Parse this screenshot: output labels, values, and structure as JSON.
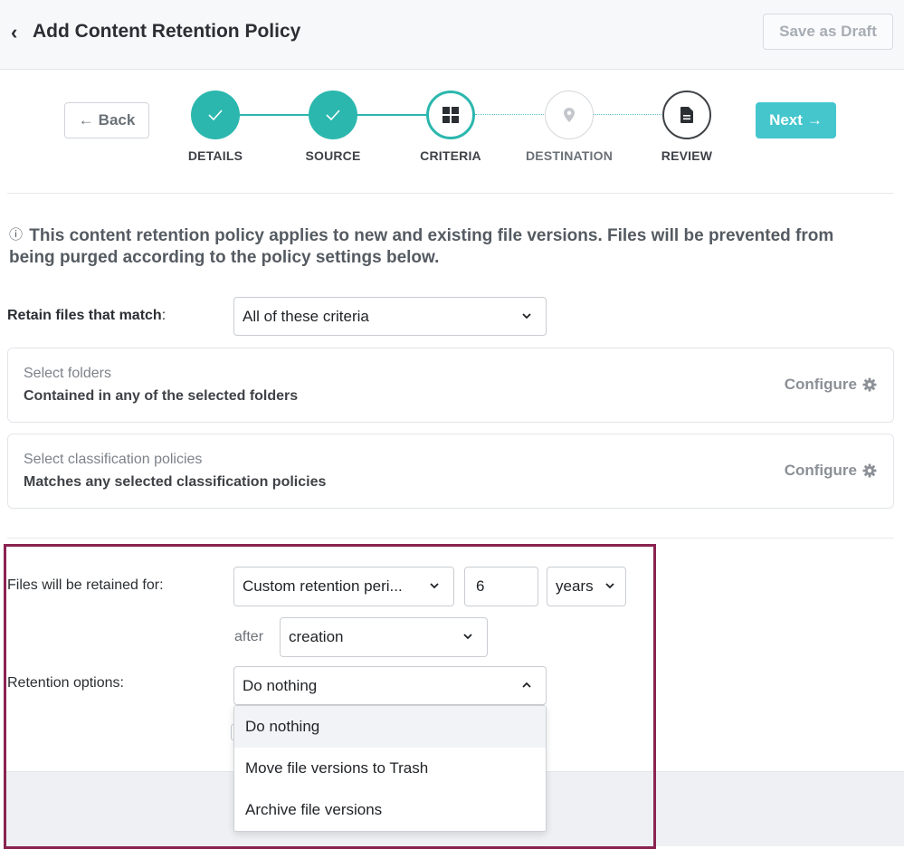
{
  "header": {
    "title": "Add Content Retention Policy",
    "save_draft_label": "Save as Draft"
  },
  "wizard": {
    "back_label": "Back",
    "next_label": "Next",
    "steps": [
      {
        "label": "DETAILS",
        "state": "done",
        "icon": "check-icon"
      },
      {
        "label": "SOURCE",
        "state": "done",
        "icon": "check-icon"
      },
      {
        "label": "CRITERIA",
        "state": "current",
        "icon": "grid-icon"
      },
      {
        "label": "DESTINATION",
        "state": "future",
        "icon": "map-pin-icon"
      },
      {
        "label": "REVIEW",
        "state": "future",
        "icon": "document-icon"
      }
    ]
  },
  "info": {
    "icon": "ⓘ",
    "text": "This content retention policy applies to new and existing file versions. Files will be prevented from being purged according to the policy settings below."
  },
  "criteria": {
    "match_label": "Retain files that match",
    "match_colon": ":",
    "match_value": "All of these criteria",
    "cards": [
      {
        "title": "Select folders",
        "subtitle": "Contained in any of the selected folders",
        "action": "Configure"
      },
      {
        "title": "Select classification policies",
        "subtitle": "Matches any selected classification policies",
        "action": "Configure"
      }
    ]
  },
  "retention": {
    "period_label": "Files will be retained for:",
    "period_value": "Custom retention peri...",
    "amount_value": "6",
    "unit_value": "years",
    "after_label": "after",
    "after_value": "creation",
    "options_label": "Retention options:",
    "options_value": "Do nothing",
    "options": [
      "Do nothing",
      "Move file versions to Trash",
      "Archive file versions"
    ]
  },
  "colors": {
    "accent": "#2bb7ae",
    "next_button": "#45c6cd",
    "highlight_border": "#8a2350"
  }
}
